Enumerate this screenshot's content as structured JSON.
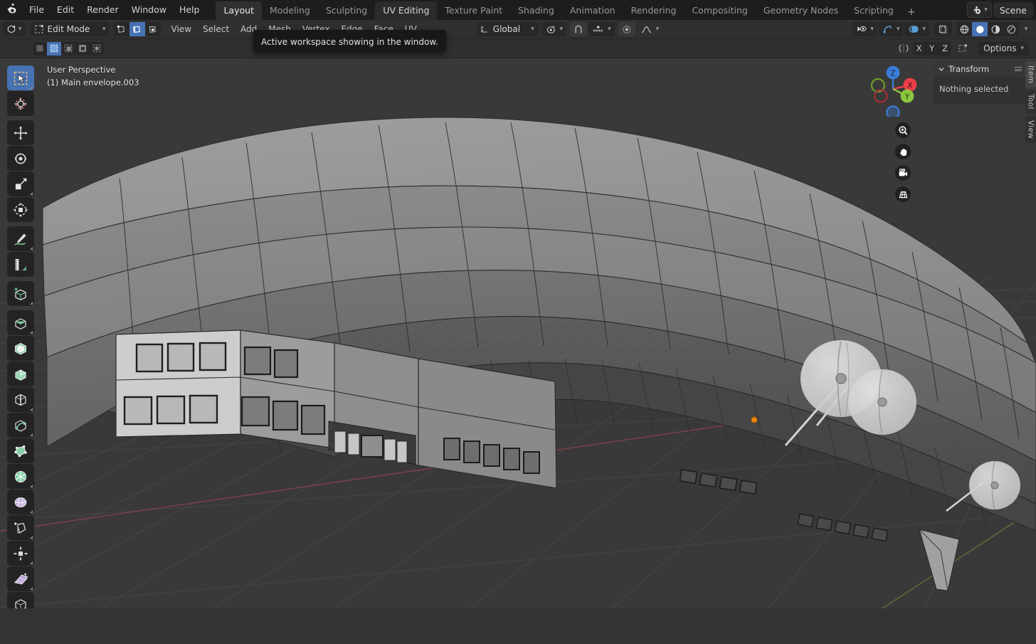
{
  "app": {
    "logo_icon": "blender-logo-icon",
    "menus": [
      "File",
      "Edit",
      "Render",
      "Window",
      "Help"
    ],
    "workspace_tabs": [
      {
        "label": "Layout",
        "state": "active"
      },
      {
        "label": "Modeling",
        "state": "normal"
      },
      {
        "label": "Sculpting",
        "state": "normal"
      },
      {
        "label": "UV Editing",
        "state": "hover"
      },
      {
        "label": "Texture Paint",
        "state": "normal"
      },
      {
        "label": "Shading",
        "state": "normal"
      },
      {
        "label": "Animation",
        "state": "normal"
      },
      {
        "label": "Rendering",
        "state": "normal"
      },
      {
        "label": "Compositing",
        "state": "normal"
      },
      {
        "label": "Geometry Nodes",
        "state": "normal"
      },
      {
        "label": "Scripting",
        "state": "normal"
      }
    ],
    "add_workspace_label": "+",
    "scene_browse_icon": "scene-icon",
    "scene_name": "Scene"
  },
  "tooltip": {
    "text": "Active workspace showing in the window."
  },
  "viewport_header": {
    "editor_type_icon": "editor-type-3dview-icon",
    "mode": "Edit Mode",
    "mesh_select_modes": [
      {
        "name": "vertex-select-icon",
        "active": false
      },
      {
        "name": "edge-select-icon",
        "active": true
      },
      {
        "name": "face-select-icon",
        "active": false
      }
    ],
    "menus": [
      "View",
      "Select",
      "Add",
      "Mesh",
      "Vertex",
      "Edge",
      "Face",
      "UV"
    ],
    "transform_orientation": "Global",
    "pivot_icon": "pivot-point-icon",
    "snap_icon": "magnet-snap-icon",
    "snap_to_icon": "snap-increment-icon",
    "proportional_edit_icon": "proportional-edit-icon",
    "falloff_icon": "smooth-falloff-icon",
    "visibility_icon": "object-types-visibility-icon",
    "gizmo_icon": "show-gizmo-icon",
    "overlays_icon": "show-overlays-icon",
    "xray_icon": "toggle-xray-icon",
    "shading_modes": [
      {
        "name": "shading-wireframe-icon",
        "active": false
      },
      {
        "name": "shading-solid-icon",
        "active": true
      },
      {
        "name": "shading-material-icon",
        "active": false
      },
      {
        "name": "shading-rendered-icon",
        "active": false
      }
    ]
  },
  "tool_header": {
    "select_modes": [
      {
        "name": "tweak-select-icon",
        "active": false
      },
      {
        "name": "box-select-icon",
        "active": true
      },
      {
        "name": "extend-select-icon",
        "active": false
      },
      {
        "name": "subtract-select-icon",
        "active": false
      },
      {
        "name": "intersect-select-icon",
        "active": false
      }
    ],
    "mirror_icon": "mesh-symmetry-icon",
    "mirror_axes": [
      "X",
      "Y",
      "Z"
    ],
    "snap_mirror_icon": "topology-mirror-icon",
    "options_label": "Options"
  },
  "toolbar": {
    "groups": [
      [
        {
          "name": "tool-select-box",
          "icon": "select-box-icon",
          "active": true,
          "sub": true
        },
        {
          "name": "tool-cursor",
          "icon": "cursor-3d-icon",
          "active": false,
          "sub": false
        }
      ],
      [
        {
          "name": "tool-move",
          "icon": "move-icon",
          "active": false,
          "sub": false
        },
        {
          "name": "tool-rotate",
          "icon": "rotate-icon",
          "active": false,
          "sub": false
        },
        {
          "name": "tool-scale",
          "icon": "scale-icon",
          "active": false,
          "sub": true
        },
        {
          "name": "tool-transform",
          "icon": "transform-icon",
          "active": false,
          "sub": false
        }
      ],
      [
        {
          "name": "tool-annotate",
          "icon": "annotate-icon",
          "active": false,
          "sub": true
        },
        {
          "name": "tool-measure",
          "icon": "measure-icon",
          "active": false,
          "sub": false
        }
      ],
      [
        {
          "name": "tool-add-cube",
          "icon": "add-cube-icon",
          "active": false,
          "sub": true
        }
      ],
      [
        {
          "name": "tool-extrude-region",
          "icon": "extrude-region-icon",
          "active": false,
          "sub": true
        },
        {
          "name": "tool-inset-faces",
          "icon": "inset-faces-icon",
          "active": false,
          "sub": false
        },
        {
          "name": "tool-bevel",
          "icon": "bevel-icon",
          "active": false,
          "sub": true
        },
        {
          "name": "tool-loop-cut",
          "icon": "loop-cut-icon",
          "active": false,
          "sub": true
        },
        {
          "name": "tool-knife",
          "icon": "knife-icon",
          "active": false,
          "sub": true
        },
        {
          "name": "tool-poly-build",
          "icon": "poly-build-icon",
          "active": false,
          "sub": false
        },
        {
          "name": "tool-spin",
          "icon": "spin-icon",
          "active": false,
          "sub": true
        },
        {
          "name": "tool-smooth",
          "icon": "smooth-icon",
          "active": false,
          "sub": true
        },
        {
          "name": "tool-edge-slide",
          "icon": "edge-slide-icon",
          "active": false,
          "sub": true
        },
        {
          "name": "tool-shrink-fatten",
          "icon": "shrink-fatten-icon",
          "active": false,
          "sub": true
        },
        {
          "name": "tool-shear",
          "icon": "shear-icon",
          "active": false,
          "sub": true
        },
        {
          "name": "tool-rip-region",
          "icon": "rip-region-icon",
          "active": false,
          "sub": false
        }
      ]
    ]
  },
  "viewport": {
    "perspective_label": "User Perspective",
    "active_object_label": "(1) Main envelope.003",
    "background_color": "#393939",
    "grid_color": "#4c4c4c",
    "origin_dot_color": "#ee8512",
    "model_description": "zeppelin airship hull with gondola and propellers"
  },
  "gizmo": {
    "axes": [
      {
        "label": "X",
        "color": "#ec3f48",
        "filled": true
      },
      {
        "label": "Y",
        "color": "#8cc63f",
        "filled": true
      },
      {
        "label": "Z",
        "color": "#3b7dd8",
        "filled": true
      }
    ],
    "nav_buttons": [
      {
        "name": "zoom-icon"
      },
      {
        "name": "pan-hand-icon"
      },
      {
        "name": "camera-view-icon"
      },
      {
        "name": "toggle-ortho-perspective-icon"
      }
    ]
  },
  "sidebar": {
    "panel_title": "Transform",
    "panel_body_text": "Nothing selected",
    "grip_icon": "panel-grip-icon",
    "collapse_icon": "chevron-down-icon",
    "tabs": [
      {
        "label": "Item",
        "active": true
      },
      {
        "label": "Tool",
        "active": false
      },
      {
        "label": "View",
        "active": false
      }
    ]
  }
}
